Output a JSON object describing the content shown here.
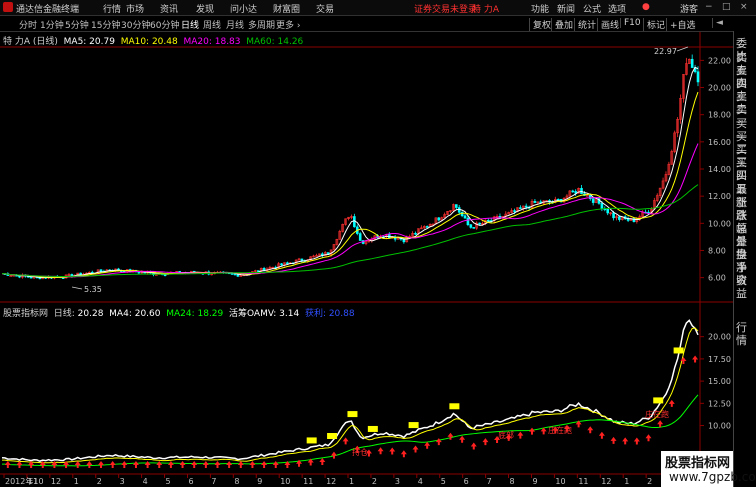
{
  "app": {
    "title": "通达信金融终端"
  },
  "menu": [
    "行情",
    "市场",
    "资讯",
    "发现",
    "问小达",
    "财富圈",
    "交易"
  ],
  "login_notice": "证券交易未登录",
  "stock_name_top": "特 力A",
  "right_menu": [
    "功能",
    "新闻",
    "公式",
    "选项"
  ],
  "guest": "游客",
  "window_controls": [
    "−",
    "□",
    "×"
  ],
  "periods": [
    "分时",
    "1分钟",
    "5分钟",
    "15分钟",
    "30分钟",
    "60分钟",
    "日线",
    "周线",
    "月线",
    "多周期",
    "更多 ›"
  ],
  "active_period": "日线",
  "right_tools": [
    "复权",
    "叠加",
    "统计",
    "画线",
    "F10",
    "标记",
    "+自选"
  ],
  "back_icon": "◄",
  "main_legend": {
    "name": "特 力A (日线)",
    "ma5": "MA5: 20.79",
    "ma10": "MA10: 20.48",
    "ma20": "MA20: 18.83",
    "ma60": "MA60: 14.26"
  },
  "sub_legend": {
    "name": "股票指标网",
    "period": "日线:",
    "v1": "20.28",
    "v2": "MA4: 20.60",
    "v3": "MA24: 18.29",
    "v4": "活筹OAMV: 3.14",
    "v5": "获利: 20.88"
  },
  "price_axis_main": [
    "22.00",
    "20.00",
    "18.00",
    "16.00",
    "14.00",
    "12.00",
    "10.00",
    "8.00",
    "6.00"
  ],
  "price_axis_sub": [
    "20.00",
    "17.50",
    "15.00",
    "12.50",
    "10.00"
  ],
  "high_label": "22.97",
  "low_label": "5.35",
  "side_panel": [
    "委比",
    "卖五",
    "卖四",
    "卖三",
    "卖二",
    "卖一",
    "买一",
    "买二",
    "买三",
    "买四",
    "买五",
    "最新",
    "涨跌",
    "涨幅",
    "总量",
    "外盘",
    "换手",
    "净资",
    "收益"
  ],
  "side_panel_bottom": [
    "行情"
  ],
  "x_axis": [
    "2012年10",
    "11",
    "12",
    "1",
    "2",
    "3",
    "4",
    "5",
    "6",
    "7",
    "8",
    "9",
    "10",
    "11",
    "12",
    "1",
    "2",
    "3",
    "4",
    "5",
    "6",
    "7",
    "8",
    "9",
    "10",
    "11",
    "12",
    "1",
    "2",
    "3"
  ],
  "sub_annotations": [
    "持仓",
    "底部",
    "庄在跑",
    "庄在跑"
  ],
  "watermark": {
    "line1": "股票指标网",
    "line2": "www.7gpzb.com"
  },
  "colors": {
    "ma5": "#ffffff",
    "ma10": "#ffff00",
    "ma20": "#ff00ff",
    "ma60": "#00c000",
    "up": "#ff3030",
    "down": "#00ffff"
  }
}
